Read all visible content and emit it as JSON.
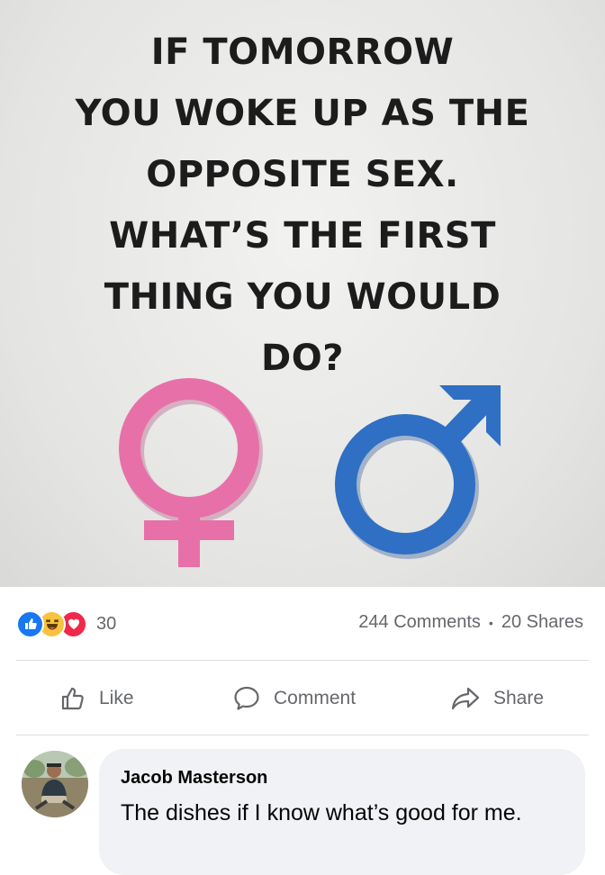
{
  "post": {
    "image_text": [
      "IF TOMORROW",
      "YOU WOKE UP AS THE",
      "OPPOSITE SEX.",
      "WHAT’S THE FIRST",
      "THING YOU WOULD",
      "DO?"
    ],
    "symbols": [
      "female-symbol",
      "male-symbol"
    ],
    "colors": {
      "female": "#e870a8",
      "male": "#2f6fc4"
    }
  },
  "stats": {
    "reaction_icons": [
      "like-reaction-icon",
      "haha-reaction-icon",
      "love-reaction-icon"
    ],
    "reaction_count": "30",
    "comments": "244 Comments",
    "shares": "20 Shares",
    "separator": "•"
  },
  "actions": {
    "like": "Like",
    "comment": "Comment",
    "share": "Share"
  },
  "comment": {
    "author": "Jacob Masterson",
    "text": "The dishes if I know what’s good for me."
  },
  "theme": {
    "facebook_blue": "#1877f2",
    "secondary_text": "#65676b",
    "bubble_bg": "#f0f2f5"
  }
}
